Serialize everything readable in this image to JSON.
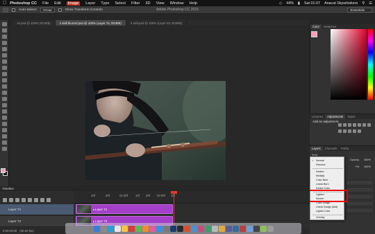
{
  "menubar": {
    "app": "Photoshop CC",
    "items": [
      "File",
      "Edit",
      "Image",
      "Layer",
      "Type",
      "Select",
      "Filter",
      "3D",
      "View",
      "Window",
      "Help"
    ],
    "active_item": "Image",
    "battery": "44%",
    "clock": "Sat 01:07",
    "user": "Anacat Skywhiskers"
  },
  "options": {
    "auto_select_label": "Auto-Select:",
    "auto_select_value": "Group",
    "show_transform_label": "Show Transform Controls",
    "workspace": "Essentials"
  },
  "window_title": "Adobe Photoshop CC 2015",
  "tabs": [
    "16.psd @ 100% (RGB/8)",
    "2 skill blurred.psd @ 100% (Layer 74, RGB/8)",
    "3 skill.psd @ 100% (Layer 53, RGB/8)"
  ],
  "active_tab_index": 1,
  "color_panel": {
    "tabs": [
      "Color",
      "Swatches"
    ],
    "foreground": "#f4a0b4"
  },
  "adjust_panel": {
    "tabs": [
      "Libraries",
      "Adjustments",
      "Styles"
    ],
    "label": "Add an adjustment"
  },
  "layers_panel": {
    "tabs": [
      "Layers",
      "Channels",
      "Paths"
    ],
    "kind": "Kind",
    "opacity_label": "Opacity:",
    "opacity_value": "100%",
    "fill_label": "Fill:",
    "fill_value": "100%"
  },
  "blend_modes": {
    "groups": [
      [
        "Normal",
        "Dissolve"
      ],
      [
        "Darken",
        "Multiply",
        "Color Burn",
        "Linear Burn",
        "Darker Color"
      ],
      [
        "Lighten",
        "Screen",
        "Color Dodge",
        "Linear Dodge (Add)",
        "Lighter Color"
      ],
      [
        "Overlay"
      ]
    ],
    "checked": "Normal",
    "highlighted": [
      "Lighten",
      "Screen"
    ]
  },
  "timeline": {
    "title": "Timeline",
    "ticks": [
      "10f",
      "20f",
      "01:00f",
      "10f",
      "20f",
      "02:00f",
      "10f"
    ],
    "tracks": [
      {
        "name": "Layer 74",
        "clip": "Layer 74",
        "selected": true
      },
      {
        "name": "Layer 73",
        "clip": "Layer 73",
        "selected": false
      }
    ],
    "footer_time": "0:00:00:00",
    "footer_fps": "(30.00 fps)"
  }
}
